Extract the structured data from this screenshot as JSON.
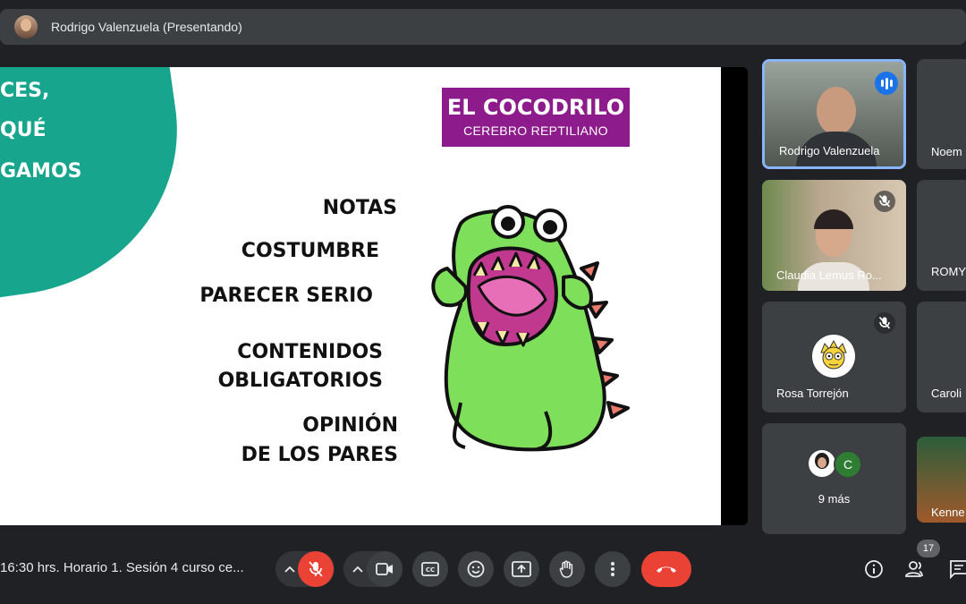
{
  "presenter_bar": {
    "name": "Rodrigo Valenzuela (Presentando)"
  },
  "slide": {
    "corner_text": [
      "CES,",
      "QUÉ",
      "GAMOS"
    ],
    "title": "EL COCODRILO",
    "subtitle": "CEREBRO REPTILIANO",
    "words": [
      "NOTAS",
      "COSTUMBRE",
      "PARECER SERIO",
      "CONTENIDOS",
      "OBLIGATORIOS",
      "OPINIÓN",
      "DE LOS PARES"
    ]
  },
  "participants": [
    {
      "name": "Rodrigo Valenzuela",
      "state": "speaking"
    },
    {
      "name": "Noem",
      "state": ""
    },
    {
      "name": "Claudia Lemus Ro...",
      "state": "muted"
    },
    {
      "name": "ROMY",
      "state": ""
    },
    {
      "name": "Rosa Torrejón",
      "state": "muted"
    },
    {
      "name": "Caroli",
      "state": ""
    },
    {
      "name": "9 más",
      "avatar_letter": "C"
    },
    {
      "name": "Kenne",
      "state": ""
    }
  ],
  "bottom": {
    "meeting_title": "16:30 hrs. Horario 1. Sesión 4 curso ce...",
    "participant_count": "17"
  },
  "colors": {
    "teal": "#17a58d",
    "purple": "#8e1b8c",
    "red": "#ea4335",
    "speaking_blue": "#1a73e8"
  }
}
